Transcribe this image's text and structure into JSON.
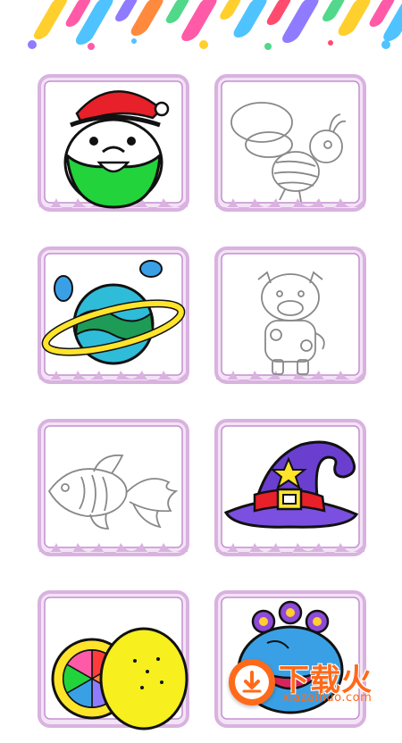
{
  "header": {
    "decoration": "rainbow-stripes",
    "stripe_colors": [
      "#ffcf2e",
      "#ff5aa8",
      "#4fc3ff",
      "#ff8a3d",
      "#8f7bff",
      "#51d88a",
      "#ff4b6e"
    ]
  },
  "theme": {
    "frame_color": "#d9b2e0",
    "frame_dark": "#c48fcf",
    "frame_light": "#f3e3f6"
  },
  "cards": [
    {
      "id": "santa",
      "state": "colored",
      "icon": "santa-icon"
    },
    {
      "id": "bee",
      "state": "outline",
      "icon": "bee-icon"
    },
    {
      "id": "planet",
      "state": "colored",
      "icon": "planet-icon"
    },
    {
      "id": "cow",
      "state": "outline",
      "icon": "cow-icon"
    },
    {
      "id": "goldfish",
      "state": "outline",
      "icon": "goldfish-icon"
    },
    {
      "id": "witch-hat",
      "state": "colored",
      "icon": "witch-hat-icon"
    },
    {
      "id": "lemon",
      "state": "colored",
      "icon": "lemon-icon"
    },
    {
      "id": "frog-monster",
      "state": "colored",
      "icon": "monster-icon"
    }
  ],
  "watermark": {
    "title": "下载火",
    "subtitle": "xiazaihuo.com",
    "icon": "download-arrow-icon"
  }
}
